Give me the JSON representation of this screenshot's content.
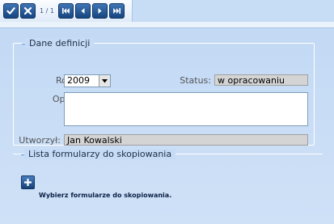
{
  "toolbar": {
    "buttons": [
      {
        "name": "confirm",
        "icon": "check-icon"
      },
      {
        "name": "cancel",
        "icon": "close-icon"
      },
      {
        "name": "first",
        "icon": "first-page-icon"
      },
      {
        "name": "prev",
        "icon": "prev-page-icon"
      },
      {
        "name": "next",
        "icon": "next-page-icon"
      },
      {
        "name": "last",
        "icon": "last-page-icon"
      }
    ],
    "pager_text": "1 / 1"
  },
  "definition": {
    "legend": "Dane definicji",
    "year_label": "Rok:",
    "year_value": "2009",
    "status_label": "Status:",
    "status_value": "w opracowaniu",
    "description_label": "Opis:",
    "description_value": "",
    "created_by_label": "Utworzył:",
    "created_by_value": "Jan Kowalski"
  },
  "forms": {
    "legend": "Lista formularzy do skopiowania",
    "add_icon": "plus-icon",
    "hint": "Wybierz formularze do skopiowania."
  },
  "colors": {
    "accent": "#4a90e2",
    "button": "#1f4f8f",
    "background": "#c7dcf5"
  }
}
